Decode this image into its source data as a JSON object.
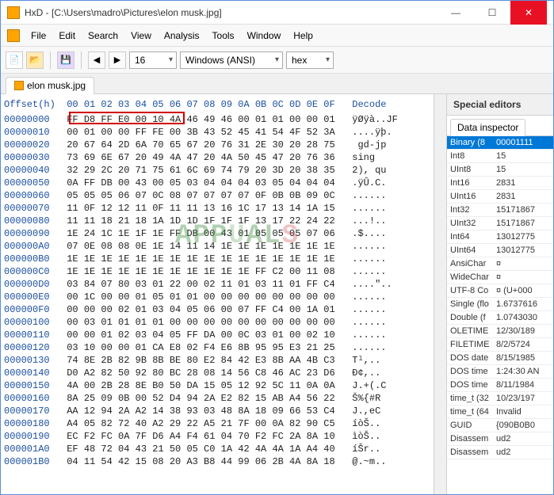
{
  "window": {
    "title": "HxD - [C:\\Users\\madro\\Pictures\\elon musk.jpg]",
    "min": "—",
    "max": "☐",
    "close": "✕"
  },
  "menu": {
    "file": "File",
    "edit": "Edit",
    "search": "Search",
    "view": "View",
    "analysis": "Analysis",
    "tools": "Tools",
    "window": "Window",
    "help": "Help"
  },
  "toolbar": {
    "bytes_per_row": "16",
    "encoding": "Windows (ANSI)",
    "base": "hex"
  },
  "tab": {
    "label": "elon musk.jpg"
  },
  "hex": {
    "header": "Offset(h)  00 01 02 03 04 05 06 07 08 09 0A 0B 0C 0D 0E 0F   Decode",
    "rows": [
      {
        "off": "00000000",
        "hex": "FF D8 FF E0 00 10 4A 46 49 46 00 01 01 00 00 01",
        "asc": "ÿØÿà..JF"
      },
      {
        "off": "00000010",
        "hex": "00 01 00 00 FF FE 00 3B 43 52 45 41 54 4F 52 3A",
        "asc": "....ÿþ."
      },
      {
        "off": "00000020",
        "hex": "20 67 64 2D 6A 70 65 67 20 76 31 2E 30 20 28 75",
        "asc": " gd-jp"
      },
      {
        "off": "00000030",
        "hex": "73 69 6E 67 20 49 4A 47 20 4A 50 45 47 20 76 36",
        "asc": "sing  "
      },
      {
        "off": "00000040",
        "hex": "32 29 2C 20 71 75 61 6C 69 74 79 20 3D 20 38 35",
        "asc": "2), qu"
      },
      {
        "off": "00000050",
        "hex": "0A FF DB 00 43 00 05 03 04 04 04 03 05 04 04 04",
        "asc": ".ÿÛ.C."
      },
      {
        "off": "00000060",
        "hex": "05 05 05 06 07 0C 08 07 07 07 07 0F 0B 0B 09 0C",
        "asc": "......"
      },
      {
        "off": "00000070",
        "hex": "11 0F 12 12 11 0F 11 11 13 16 1C 17 13 14 1A 15",
        "asc": "......"
      },
      {
        "off": "00000080",
        "hex": "11 11 18 21 18 1A 1D 1D 1F 1F 1F 13 17 22 24 22",
        "asc": "...!.."
      },
      {
        "off": "00000090",
        "hex": "1E 24 1C 1E 1F 1E FF DB 00 43 01 05 05 05 07 06",
        "asc": ".$...."
      },
      {
        "off": "000000A0",
        "hex": "07 0E 08 08 0E 1E 14 11 14 1E 1E 1E 1E 1E 1E 1E",
        "asc": "......"
      },
      {
        "off": "000000B0",
        "hex": "1E 1E 1E 1E 1E 1E 1E 1E 1E 1E 1E 1E 1E 1E 1E 1E",
        "asc": "......"
      },
      {
        "off": "000000C0",
        "hex": "1E 1E 1E 1E 1E 1E 1E 1E 1E 1E 1E FF C2 00 11 08",
        "asc": "......"
      },
      {
        "off": "000000D0",
        "hex": "03 84 07 80 03 01 22 00 02 11 01 03 11 01 FF C4",
        "asc": "....\".."
      },
      {
        "off": "000000E0",
        "hex": "00 1C 00 00 01 05 01 01 00 00 00 00 00 00 00 00",
        "asc": "......"
      },
      {
        "off": "000000F0",
        "hex": "00 00 00 02 01 03 04 05 06 00 07 FF C4 00 1A 01",
        "asc": "......"
      },
      {
        "off": "00000100",
        "hex": "00 03 01 01 01 01 00 00 00 00 00 00 00 00 00 00",
        "asc": "......"
      },
      {
        "off": "00000110",
        "hex": "00 00 01 02 03 04 05 FF DA 00 0C 03 01 00 02 10",
        "asc": "......"
      },
      {
        "off": "00000120",
        "hex": "03 10 00 00 01 CA E8 02 F4 E6 8B 95 95 E3 21 25",
        "asc": "......"
      },
      {
        "off": "00000130",
        "hex": "74 8E 2B 82 9B 8B BE 80 E2 84 42 E3 8B AA 4B C3",
        "asc": "Tˡ,.."
      },
      {
        "off": "00000140",
        "hex": "D0 A2 82 50 92 80 BC 28 08 14 56 C8 46 AC 23 D6",
        "asc": "Đ¢,.."
      },
      {
        "off": "00000150",
        "hex": "4A 00 2B 28 8E B0 50 DA 15 05 12 92 5C 11 0A 0A",
        "asc": "J.+(.C"
      },
      {
        "off": "00000160",
        "hex": "8A 25 09 0B 00 52 D4 94 2A E2 82 15 AB A4 56 22",
        "asc": "Š%{#R"
      },
      {
        "off": "00000170",
        "hex": "AA 12 94 2A A2 14 38 93 03 48 8A 18 09 66 53 C4",
        "asc": "J.,eC"
      },
      {
        "off": "00000180",
        "hex": "A4 05 82 72 40 A2 29 22 A5 21 7F 00 0A 82 90 C5",
        "asc": "íòŠ.."
      },
      {
        "off": "00000190",
        "hex": "EC F2 FC 0A 7F D6 A4 F4 61 04 70 F2 FC 2A 8A 10",
        "asc": "ìòŠ.."
      },
      {
        "off": "000001A0",
        "hex": "EF 48 72 04 43 21 50 05 C0 1A 42 4A 4A 1A A4 40",
        "asc": "íŠr.."
      },
      {
        "off": "000001B0",
        "hex": "04 11 54 42 15 08 20 A3 B8 44 99 06 2B 4A 8A 18",
        "asc": "@.~m.."
      }
    ]
  },
  "sidebar": {
    "title": "Special editors",
    "tab": "Data inspector",
    "rows": [
      {
        "k": "Binary (8",
        "v": "00001111"
      },
      {
        "k": "Int8",
        "v": "15"
      },
      {
        "k": "UInt8",
        "v": "15"
      },
      {
        "k": "Int16",
        "v": "2831"
      },
      {
        "k": "UInt16",
        "v": "2831"
      },
      {
        "k": "Int32",
        "v": "15171867"
      },
      {
        "k": "UInt32",
        "v": "15171867"
      },
      {
        "k": "Int64",
        "v": "13012775"
      },
      {
        "k": "UInt64",
        "v": "13012775"
      },
      {
        "k": "AnsiChar",
        "v": "¤"
      },
      {
        "k": "WideChar",
        "v": "¤"
      },
      {
        "k": "UTF-8 Co",
        "v": "¤ (U+000"
      },
      {
        "k": "Single (flo",
        "v": "1.6737616"
      },
      {
        "k": "Double (f",
        "v": "1.0743030"
      },
      {
        "k": "OLETIME",
        "v": "12/30/189"
      },
      {
        "k": "FILETIME",
        "v": "8/2/5724"
      },
      {
        "k": "DOS date",
        "v": "8/15/1985"
      },
      {
        "k": "DOS time",
        "v": "1:24:30 AN"
      },
      {
        "k": "DOS time",
        "v": "8/11/1984"
      },
      {
        "k": "time_t (32",
        "v": "10/23/197"
      },
      {
        "k": "time_t (64",
        "v": "Invalid"
      },
      {
        "k": "GUID",
        "v": "{090B0B0"
      },
      {
        "k": "Disassem",
        "v": "ud2"
      },
      {
        "k": "Disassem",
        "v": "ud2"
      }
    ]
  }
}
